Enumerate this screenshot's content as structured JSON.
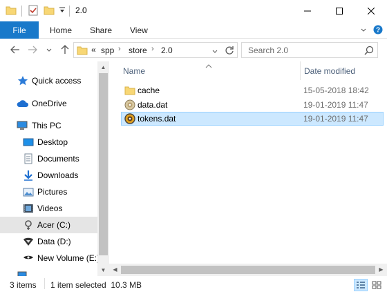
{
  "window": {
    "title": "2.0"
  },
  "ribbon": {
    "tabs": [
      "File",
      "Home",
      "Share",
      "View"
    ]
  },
  "address": {
    "prefix": "«",
    "crumbs": [
      "spp",
      "store",
      "2.0"
    ]
  },
  "search": {
    "placeholder": "Search 2.0"
  },
  "nav": {
    "items": [
      {
        "label": "Quick access",
        "icon": "star-icon"
      },
      {
        "label": "OneDrive",
        "icon": "cloud-icon"
      },
      {
        "label": "This PC",
        "icon": "computer-icon"
      },
      {
        "label": "Desktop",
        "icon": "desktop-icon"
      },
      {
        "label": "Documents",
        "icon": "documents-icon"
      },
      {
        "label": "Downloads",
        "icon": "downloads-icon"
      },
      {
        "label": "Pictures",
        "icon": "pictures-icon"
      },
      {
        "label": "Videos",
        "icon": "videos-icon"
      },
      {
        "label": "Acer (C:)",
        "icon": "drive-icon"
      },
      {
        "label": "Data (D:)",
        "icon": "drive-icon"
      },
      {
        "label": "New Volume (E:)",
        "icon": "drive-icon"
      }
    ]
  },
  "columns": {
    "name": "Name",
    "date": "Date modified"
  },
  "files": [
    {
      "name": "cache",
      "date": "15-05-2018 18:42",
      "icon": "folder-icon"
    },
    {
      "name": "data.dat",
      "date": "19-01-2019 11:47",
      "icon": "dat-file-icon"
    },
    {
      "name": "tokens.dat",
      "date": "19-01-2019 11:47",
      "icon": "dat-file-icon"
    }
  ],
  "status": {
    "count": "3 items",
    "selection": "1 item selected  10.3 MB"
  },
  "colors": {
    "accent": "#1979ca",
    "selection_bg": "#cce8ff",
    "selection_border": "#99d1ff",
    "folder": "#f8d775"
  }
}
